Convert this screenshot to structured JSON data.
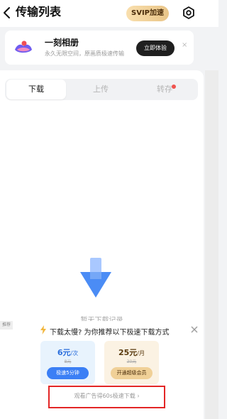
{
  "header": {
    "title": "传输列表",
    "svip_label": "SVIP加速",
    "back_icon": "back-arrow-icon",
    "settings_icon": "gear-icon"
  },
  "promo": {
    "title": "一刻相册",
    "subtitle": "永久无限空间，原画质极速传输",
    "button_label": "立即体验",
    "close_label": "×"
  },
  "tabs": [
    {
      "label": "下载",
      "active": true
    },
    {
      "label": "上传",
      "active": false
    },
    {
      "label": "转存",
      "active": false,
      "badge_dot": true
    }
  ],
  "empty_state": {
    "text": "暂无下载记录",
    "icon": "download-arrow-icon"
  },
  "speed_sheet": {
    "tag": "推荐",
    "message": "下载太慢? 为你推荐以下极速下载方式",
    "close_label": "×",
    "offers": [
      {
        "price": "6元",
        "unit": "/次",
        "original": "8元",
        "button": "极速5分钟"
      },
      {
        "price": "25元",
        "unit": "/月",
        "original": "30元",
        "button": "开通超级会员"
      }
    ],
    "ad_label": "观看广告得60s极速下载 ›"
  },
  "colors": {
    "accent_blue": "#3b7ff5",
    "gold": "#e9c588",
    "badge_red": "#f0544f",
    "highlight_red": "#e32626"
  }
}
